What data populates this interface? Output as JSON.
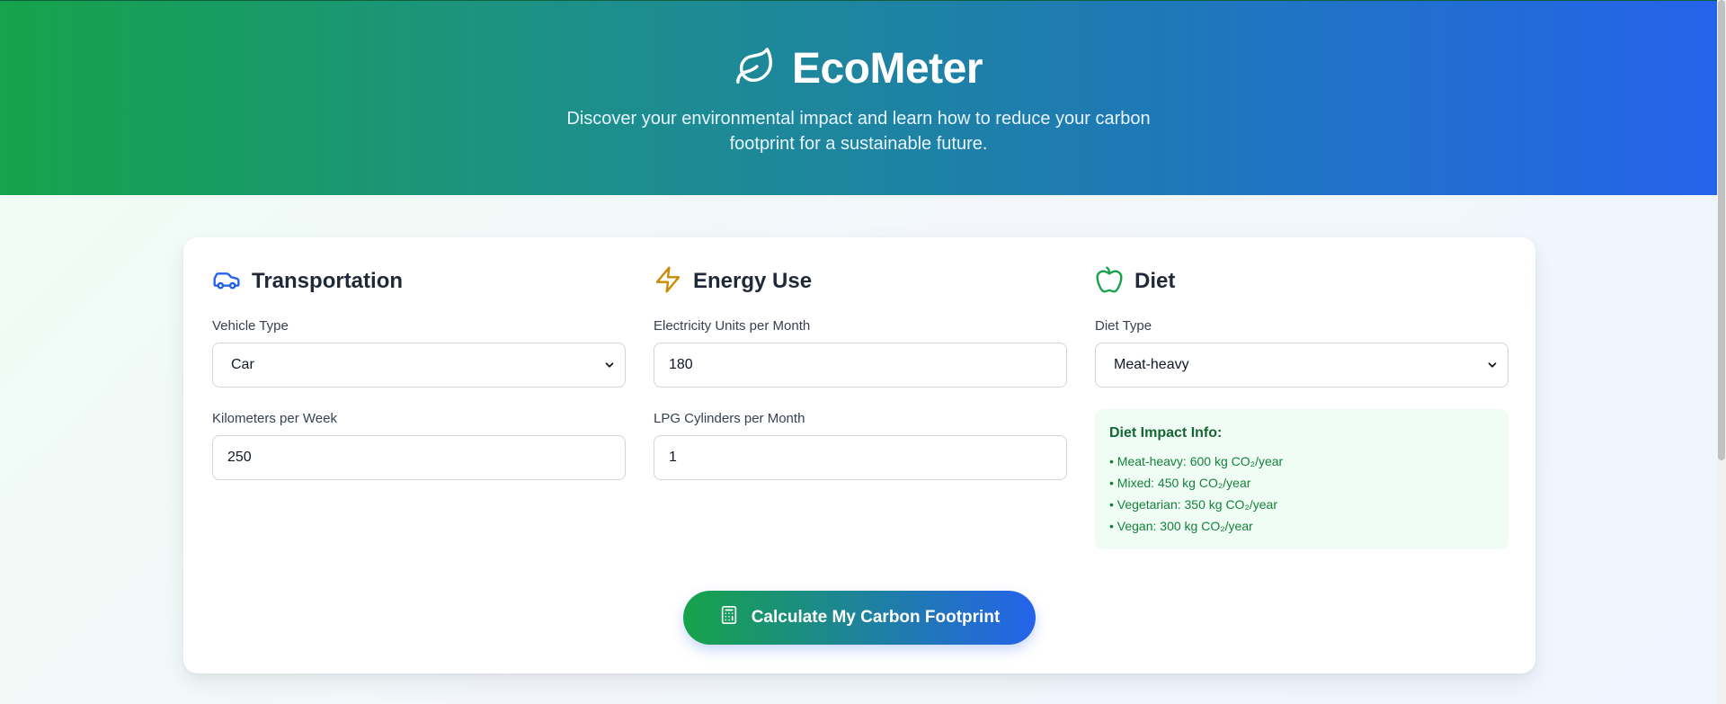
{
  "header": {
    "title": "EcoMeter",
    "subtitle": "Discover your environmental impact and learn how to reduce your carbon footprint for a sustainable future.",
    "icon": "leaf-icon"
  },
  "transportation": {
    "title": "Transportation",
    "icon": "car-icon",
    "vehicle_label": "Vehicle Type",
    "vehicle_value": "Car",
    "km_label": "Kilometers per Week",
    "km_value": "250"
  },
  "energy": {
    "title": "Energy Use",
    "icon": "lightning-icon",
    "electricity_label": "Electricity Units per Month",
    "electricity_value": "180",
    "lpg_label": "LPG Cylinders per Month",
    "lpg_value": "1"
  },
  "diet": {
    "title": "Diet",
    "icon": "apple-icon",
    "type_label": "Diet Type",
    "type_value": "Meat-heavy",
    "info_title": "Diet Impact Info:",
    "info_items": [
      "• Meat-heavy: 600 kg CO₂/year",
      "• Mixed: 450 kg CO₂/year",
      "• Vegetarian: 350 kg CO₂/year",
      "• Vegan: 300 kg CO₂/year"
    ]
  },
  "actions": {
    "calculate_label": "Calculate My Carbon Footprint",
    "calculate_icon": "calculator-icon"
  },
  "colors": {
    "primary_green": "#16a34a",
    "primary_blue": "#2563eb",
    "energy_amber": "#ca8a04",
    "info_bg": "#f0fdf4"
  }
}
